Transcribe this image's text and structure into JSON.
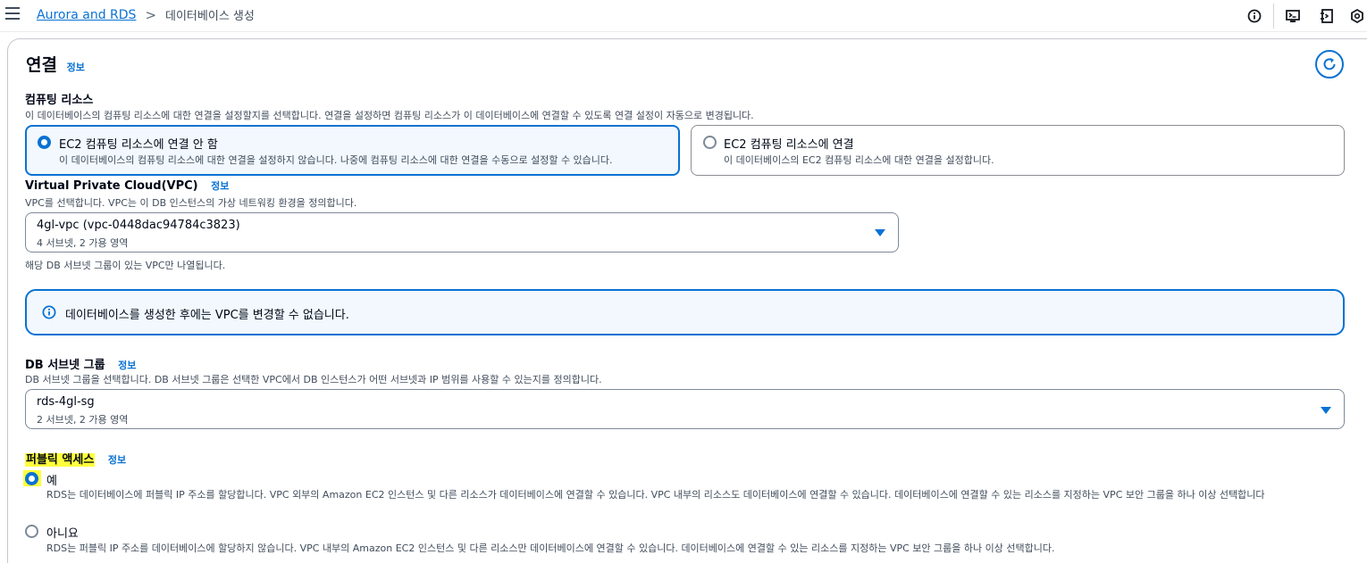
{
  "header": {
    "breadcrumb_root": "Aurora and RDS",
    "breadcrumb_separator": ">",
    "breadcrumb_current": "데이터베이스 생성",
    "icons": [
      "menu-icon",
      "info-icon",
      "cloudshell-icon",
      "feedback-icon",
      "settings-icon"
    ]
  },
  "section": {
    "title": "연결",
    "info_label": "정보"
  },
  "compute": {
    "label": "컴퓨팅 리소스",
    "description": "이 데이터베이스의 컴퓨팅 리소스에 대한 연결을 설정할지를 선택합니다. 연결을 설정하면 컴퓨팅 리소스가 이 데이터베이스에 연결할 수 있도록 연결 설정이 자동으로 변경됩니다.",
    "options": [
      {
        "title": "EC2 컴퓨팅 리소스에 연결 안 함",
        "description": "이 데이터베이스의 컴퓨팅 리소스에 대한 연결을 설정하지 않습니다. 나중에 컴퓨팅 리소스에 대한 연결을 수동으로 설정할 수 있습니다.",
        "selected": true
      },
      {
        "title": "EC2 컴퓨팅 리소스에 연결",
        "description": "이 데이터베이스의 EC2 컴퓨팅 리소스에 대한 연결을 설정합니다.",
        "selected": false
      }
    ]
  },
  "vpc": {
    "label": "Virtual Private Cloud(VPC)",
    "info_label": "정보",
    "description": "VPC를 선택합니다. VPC는 이 DB 인스턴스의 가상 네트워킹 환경을 정의합니다.",
    "selected_value": "4gl-vpc (vpc-0448dac94784c3823)",
    "selected_sub": "4 서브넷, 2 가용 영역",
    "hint": "해당 DB 서브넷 그룹이 있는 VPC만 나열됩니다."
  },
  "alert": {
    "text": "데이터베이스를 생성한 후에는 VPC를 변경할 수 없습니다."
  },
  "subnet_group": {
    "label": "DB 서브넷 그룹",
    "info_label": "정보",
    "description": "DB 서브넷 그룹을 선택합니다. DB 서브넷 그룹은 선택한 VPC에서 DB 인스턴스가 어떤 서브넷과 IP 범위를 사용할 수 있는지를 정의합니다.",
    "selected_value": "rds-4gl-sg",
    "selected_sub": "2 서브넷, 2 가용 영역"
  },
  "public_access": {
    "label": "퍼블릭 액세스",
    "info_label": "정보",
    "options": [
      {
        "title": "예",
        "description": "RDS는 데이터베이스에 퍼블릭 IP 주소를 할당합니다. VPC 외부의 Amazon EC2 인스턴스 및 다른 리소스가 데이터베이스에 연결할 수 있습니다. VPC 내부의 리소스도 데이터베이스에 연결할 수 있습니다. 데이터베이스에 연결할 수 있는 리소스를 지정하는 VPC 보안 그룹을 하나 이상 선택합니다",
        "selected": true
      },
      {
        "title": "아니요",
        "description": "RDS는 퍼블릭 IP 주소를 데이터베이스에 할당하지 않습니다. VPC 내부의 Amazon EC2 인스턴스 및 다른 리소스만 데이터베이스에 연결할 수 있습니다. 데이터베이스에 연결할 수 있는 리소스를 지정하는 VPC 보안 그룹을 하나 이상 선택합니다.",
        "selected": false
      }
    ]
  },
  "colors": {
    "accent": "#0972d3",
    "highlight": "#ffff3b",
    "text": "#000716",
    "muted": "#414d5c"
  }
}
